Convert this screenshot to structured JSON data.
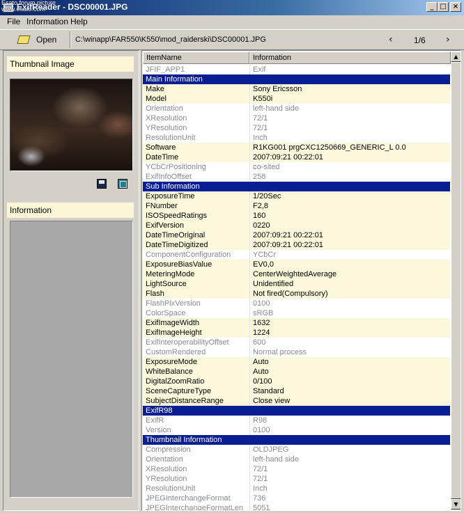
{
  "window": {
    "title": "ExifReader - DSC00001.JPG",
    "watermark_line1": "Esato forum picture",
    "watermark_line2": "www.esato.com",
    "min_glyph": "_",
    "max_glyph": "□",
    "close_glyph": "×"
  },
  "menu": [
    "File",
    "Information",
    "Help"
  ],
  "toolbar": {
    "open_label": "Open",
    "path": "C:\\winapp\\FAR550\\K550\\mod_raiderski\\DSC00001.JPG",
    "prev_glyph": "‹",
    "page": "1/6",
    "next_glyph": "›"
  },
  "left": {
    "thumbnail_label": "Thumbnail Image",
    "information_label": "Information"
  },
  "table": {
    "col_item": "ItemName",
    "col_info": "Information",
    "rows": [
      {
        "name": "JFIF_APP1",
        "value": "Exif",
        "style": "dim"
      },
      {
        "name": "Main Information",
        "value": "",
        "style": "section"
      },
      {
        "name": "Make",
        "value": "Sony Ericsson",
        "style": "hl"
      },
      {
        "name": "Model",
        "value": "K550i",
        "style": "hl"
      },
      {
        "name": "Orientation",
        "value": "left-hand side",
        "style": "dim"
      },
      {
        "name": "XResolution",
        "value": "72/1",
        "style": "dim"
      },
      {
        "name": "YResolution",
        "value": "72/1",
        "style": "dim"
      },
      {
        "name": "ResolutionUnit",
        "value": "Inch",
        "style": "dim"
      },
      {
        "name": "Software",
        "value": "R1KG001     prgCXC1250669_GENERIC_L 0.0",
        "style": "hl"
      },
      {
        "name": "DateTime",
        "value": "2007:09:21 00:22:01",
        "style": "hl"
      },
      {
        "name": "YCbCrPositioning",
        "value": "co-sited",
        "style": "dim"
      },
      {
        "name": "ExifInfoOffset",
        "value": "258",
        "style": "dim"
      },
      {
        "name": "Sub Information",
        "value": "",
        "style": "section"
      },
      {
        "name": "ExposureTime",
        "value": "1/20Sec",
        "style": "hl"
      },
      {
        "name": "FNumber",
        "value": "F2,8",
        "style": "hl"
      },
      {
        "name": "ISOSpeedRatings",
        "value": "160",
        "style": "hl"
      },
      {
        "name": "ExifVersion",
        "value": "0220",
        "style": "hl"
      },
      {
        "name": "DateTimeOriginal",
        "value": "2007:09:21 00:22:01",
        "style": "hl"
      },
      {
        "name": "DateTimeDigitized",
        "value": "2007:09:21 00:22:01",
        "style": "hl"
      },
      {
        "name": "ComponentConfiguration",
        "value": "YCbCr",
        "style": "dim"
      },
      {
        "name": "ExposureBiasValue",
        "value": "EV0,0",
        "style": "hl"
      },
      {
        "name": "MeteringMode",
        "value": "CenterWeightedAverage",
        "style": "hl"
      },
      {
        "name": "LightSource",
        "value": "Unidentified",
        "style": "hl"
      },
      {
        "name": "Flash",
        "value": "Not fired(Compulsory)",
        "style": "hl"
      },
      {
        "name": "FlashPixVersion",
        "value": "0100",
        "style": "dim"
      },
      {
        "name": "ColorSpace",
        "value": "sRGB",
        "style": "dim"
      },
      {
        "name": "ExifImageWidth",
        "value": "1632",
        "style": "hl"
      },
      {
        "name": "ExifImageHeight",
        "value": "1224",
        "style": "hl"
      },
      {
        "name": "ExifInteroperabilityOffset",
        "value": "600",
        "style": "dim"
      },
      {
        "name": "CustomRendered",
        "value": "Normal process",
        "style": "dim"
      },
      {
        "name": "ExposureMode",
        "value": "Auto",
        "style": "hl"
      },
      {
        "name": "WhiteBalance",
        "value": "Auto",
        "style": "hl"
      },
      {
        "name": "DigitalZoomRatio",
        "value": "0/100",
        "style": "hl"
      },
      {
        "name": "SceneCaptureType",
        "value": "Standard",
        "style": "hl"
      },
      {
        "name": "SubjectDistanceRange",
        "value": "Close view",
        "style": "hl"
      },
      {
        "name": "ExifR98",
        "value": "",
        "style": "section"
      },
      {
        "name": "ExifR",
        "value": "R98",
        "style": "dim"
      },
      {
        "name": "Version",
        "value": "0100",
        "style": "dim"
      },
      {
        "name": "Thumbnail Information",
        "value": "",
        "style": "section"
      },
      {
        "name": "Compression",
        "value": "OLDJPEG",
        "style": "dim"
      },
      {
        "name": "Orientation",
        "value": "left-hand side",
        "style": "dim"
      },
      {
        "name": "XResolution",
        "value": "72/1",
        "style": "dim"
      },
      {
        "name": "YResolution",
        "value": "72/1",
        "style": "dim"
      },
      {
        "name": "ResolutionUnit",
        "value": "Inch",
        "style": "dim"
      },
      {
        "name": "JPEGInterchangeFormat",
        "value": "736",
        "style": "dim"
      },
      {
        "name": "JPEGInterchangeFormatLen",
        "value": "5051",
        "style": "dim"
      }
    ]
  },
  "colors": {
    "section_bg": "#0a1e94",
    "highlight_bg": "#fcf8dc",
    "dim_text": "#8c8c8c",
    "title_start": "#0a246a"
  }
}
